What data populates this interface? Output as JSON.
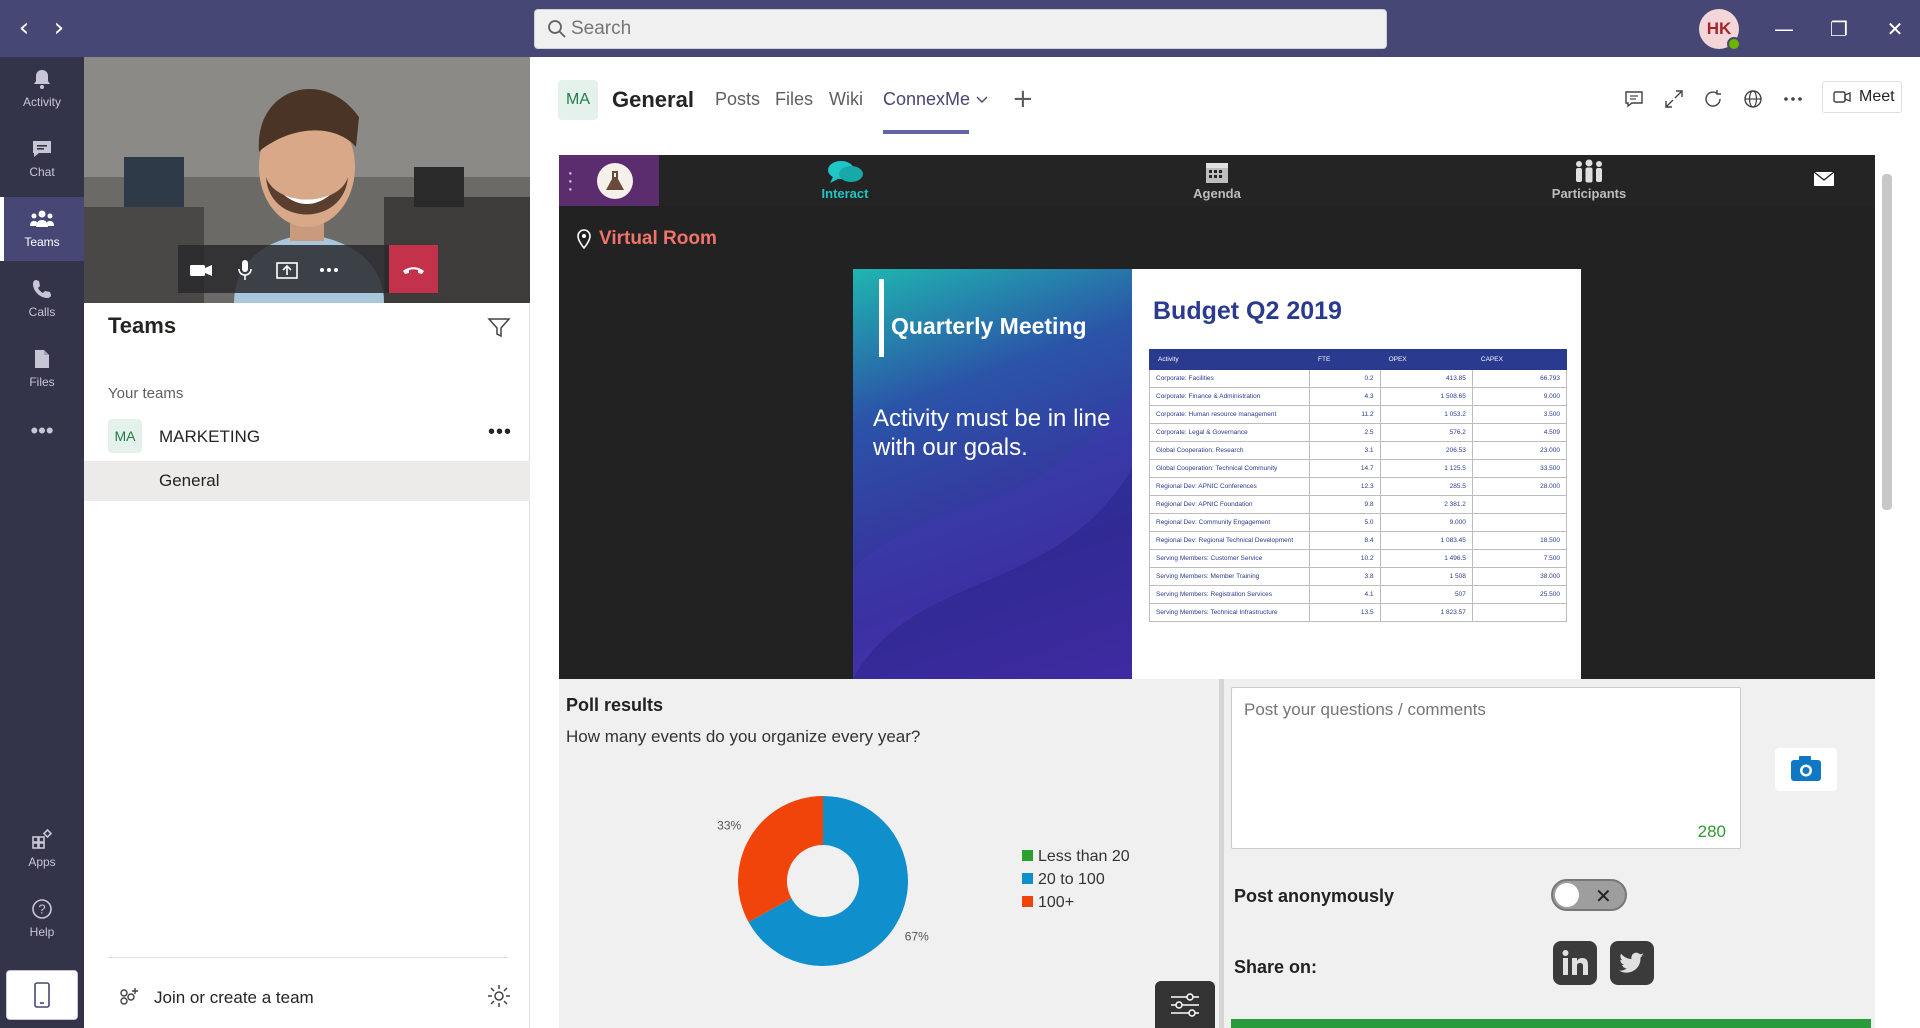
{
  "titlebar": {
    "search_placeholder": "Search",
    "avatar_initials": "HK"
  },
  "rail": {
    "items": [
      {
        "label": "Activity",
        "icon": "bell-icon"
      },
      {
        "label": "Chat",
        "icon": "chat-icon"
      },
      {
        "label": "Teams",
        "icon": "teams-icon",
        "active": true
      },
      {
        "label": "Calls",
        "icon": "phone-icon"
      },
      {
        "label": "Files",
        "icon": "files-icon"
      },
      {
        "label": "Apps",
        "icon": "apps-icon"
      },
      {
        "label": "Help",
        "icon": "help-icon"
      }
    ]
  },
  "teams_pane": {
    "title": "Teams",
    "section_label": "Your teams",
    "team": {
      "badge": "MA",
      "name": "MARKETING",
      "more": "•••"
    },
    "channel": "General",
    "join_label": "Join or create a team"
  },
  "channel_header": {
    "badge": "MA",
    "title": "General",
    "tabs": [
      "Posts",
      "Files",
      "Wiki",
      "ConnexMe"
    ],
    "active_tab": "ConnexMe",
    "meet_label": "Meet"
  },
  "app": {
    "nav": [
      {
        "label": "Interact",
        "icon": "chat-bubbles-icon",
        "active": true
      },
      {
        "label": "Agenda",
        "icon": "calendar-icon"
      },
      {
        "label": "Participants",
        "icon": "people-icon"
      }
    ],
    "room_label": "Virtual Room",
    "slide": {
      "heading": "Quarterly Meeting",
      "text": "Activity must be in line with our goals.",
      "title": "Budget Q2 2019",
      "columns": [
        "Activity",
        "FTE",
        "OPEX",
        "CAPEX"
      ],
      "rows": [
        [
          "Corporate: Facilities",
          "0.2",
          "413.85",
          "66.793"
        ],
        [
          "Corporate: Finance & Administration",
          "4.3",
          "1 508.65",
          "9.000"
        ],
        [
          "Corporate: Human resource management",
          "11.2",
          "1 053.2",
          "3.500"
        ],
        [
          "Corporate: Legal & Governance",
          "2.5",
          "576.2",
          "4.509"
        ],
        [
          "Global Cooperation: Research",
          "3.1",
          "206.53",
          "23.000"
        ],
        [
          "Global Cooperation: Technical Community",
          "14.7",
          "1 125.5",
          "33.500"
        ],
        [
          "Regional Dev: APNIC Conferences",
          "12.3",
          "285.5",
          "28.000"
        ],
        [
          "Regional Dev: APNIC Foundation",
          "9.8",
          "2 381.2",
          ""
        ],
        [
          "Regional Dev: Community Engagement",
          "5.0",
          "9.000",
          ""
        ],
        [
          "Regional Dev: Regional Technical Development",
          "8.4",
          "1 083.45",
          "18.500"
        ],
        [
          "Serving Members: Customer Service",
          "10.2",
          "1 496.5",
          "7.500"
        ],
        [
          "Serving Members: Member Training",
          "3.8",
          "1 508",
          "38.000"
        ],
        [
          "Serving Members: Registration Services",
          "4.1",
          "507",
          "25.500"
        ],
        [
          "Serving Members: Technical Infrastructure",
          "13.5",
          "1 823.57",
          ""
        ]
      ]
    },
    "poll": {
      "title": "Poll results",
      "question": "How many events do you organize every year?",
      "legend": [
        {
          "label": "Less than 20",
          "color": "#2ca02c"
        },
        {
          "label": "20 to 100",
          "color": "#0f8fcc"
        },
        {
          "label": "100+",
          "color": "#f1440a"
        }
      ]
    },
    "comments": {
      "placeholder": "Post your questions / comments",
      "char_count": "280",
      "anon_label": "Post anonymously",
      "share_label": "Share on:"
    }
  },
  "chart_data": {
    "type": "pie",
    "categories": [
      "Less than 20",
      "20 to 100",
      "100+"
    ],
    "values": [
      0,
      67,
      33
    ],
    "labels": [
      "",
      "67%",
      "33%"
    ],
    "colors": [
      "#2ca02c",
      "#0f8fcc",
      "#f1440a"
    ],
    "legend_position": "right"
  }
}
